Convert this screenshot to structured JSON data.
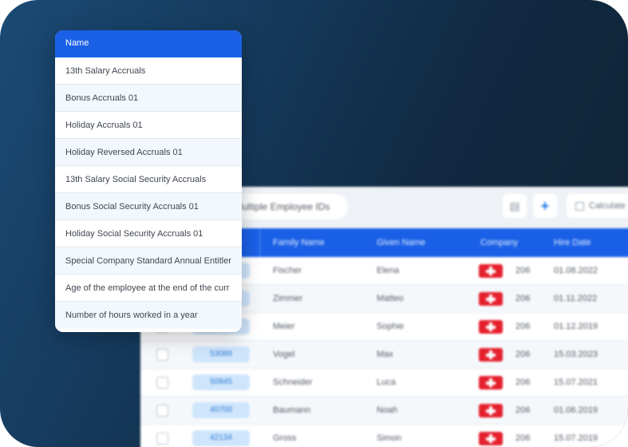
{
  "dropdown": {
    "header": "Name",
    "items": [
      "13th Salary Accruals",
      "Bonus Accruals 01",
      "Holiday Accruals 01",
      "Holiday Reversed Accruals 01",
      "13th Salary Social Security Accruals",
      "Bonus Social Security Accruals 01",
      "Holiday Social Security Accruals 01",
      "Special Company Standard Annual Entitler",
      "Age of the employee at the end of the curr",
      "Number of hours worked in a year"
    ]
  },
  "toolbar": {
    "search_text": "Multiple Employee IDs",
    "doc_icon": "document-icon",
    "add_icon": "plus-icon",
    "calculate_label": "Calculate"
  },
  "table": {
    "columns": [
      "Family Name",
      "Given Name",
      "Company",
      "Hire Date"
    ],
    "rows": [
      {
        "id": "",
        "family": "Fischer",
        "given": "Elena",
        "company": "206",
        "hire": "01.08.2022"
      },
      {
        "id": "",
        "family": "Zimmer",
        "given": "Matteo",
        "company": "206",
        "hire": "01.11.2022"
      },
      {
        "id": "",
        "family": "Meier",
        "given": "Sophie",
        "company": "206",
        "hire": "01.12.2019"
      },
      {
        "id": "53089",
        "family": "Vogel",
        "given": "Max",
        "company": "206",
        "hire": "15.03.2023"
      },
      {
        "id": "50945",
        "family": "Schneider",
        "given": "Luca",
        "company": "206",
        "hire": "15.07.2021"
      },
      {
        "id": "40700",
        "family": "Baumann",
        "given": "Noah",
        "company": "206",
        "hire": "01.06.2019"
      },
      {
        "id": "42134",
        "family": "Gross",
        "given": "Simon",
        "company": "206",
        "hire": "15.07.2019"
      }
    ]
  },
  "colors": {
    "accent": "#1a60e6",
    "flag_red": "#e5202d",
    "id_chip": "#cfe5fb",
    "background_dark": "#0f2233"
  }
}
